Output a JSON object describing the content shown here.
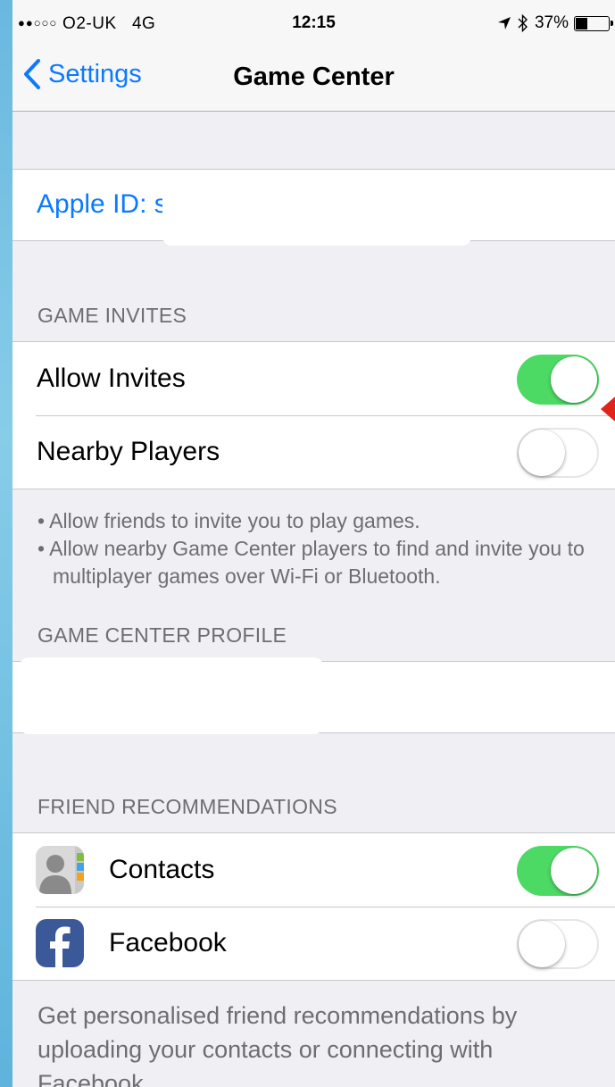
{
  "status_bar": {
    "signal_dots": "●●○○○",
    "carrier": "O2-UK",
    "network": "4G",
    "time": "12:15",
    "battery_percent": "37%",
    "battery_level": 0.37
  },
  "nav": {
    "back_label": "Settings",
    "title": "Game Center"
  },
  "apple_id": {
    "label": "Apple ID: s"
  },
  "game_invites": {
    "header": "GAME INVITES",
    "allow_invites": {
      "label": "Allow Invites",
      "on": true
    },
    "nearby_players": {
      "label": "Nearby Players",
      "on": false
    },
    "footer_lines": [
      "• Allow friends to invite you to play games.",
      "• Allow nearby Game Center players to find and invite you to multiplayer games over Wi-Fi or Bluetooth."
    ]
  },
  "profile": {
    "header": "GAME CENTER PROFILE"
  },
  "friend_recommendations": {
    "header": "FRIEND RECOMMENDATIONS",
    "contacts": {
      "label": "Contacts",
      "on": true,
      "icon": "contacts-icon"
    },
    "facebook": {
      "label": "Facebook",
      "on": false,
      "icon": "facebook-icon"
    },
    "footer": "Get personalised friend recommendations by uploading your contacts or connecting with Facebook."
  },
  "colors": {
    "tint": "#0a7aff",
    "switch_on": "#4cd964",
    "background": "#efeff4",
    "facebook": "#3b5998"
  }
}
